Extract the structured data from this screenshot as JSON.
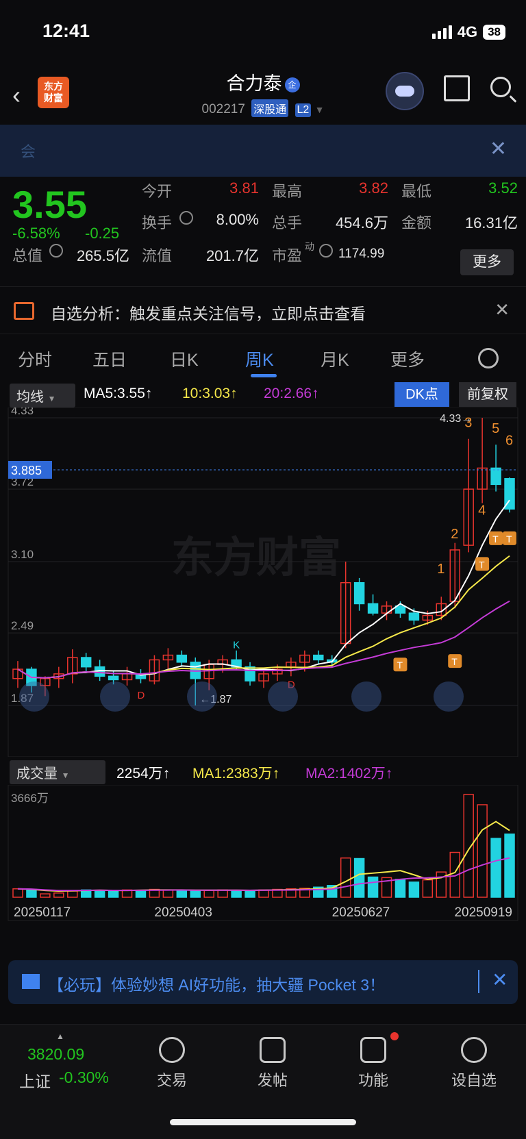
{
  "status": {
    "time": "12:41",
    "network": "4G",
    "battery": "38"
  },
  "header": {
    "title": "合力泰",
    "title_badge": "企",
    "code": "002217",
    "market_tag": "深股通",
    "level_tag": "L2"
  },
  "notice": {
    "text": "会"
  },
  "quote": {
    "price": "3.55",
    "change_pct": "-6.58%",
    "change": "-0.25",
    "open_label": "今开",
    "open": "3.81",
    "high_label": "最高",
    "high": "3.82",
    "low_label": "最低",
    "low": "3.52",
    "turnover_label": "换手",
    "turnover": "8.00%",
    "volume_label": "总手",
    "volume": "454.6万",
    "amount_label": "金额",
    "amount": "16.31亿",
    "mktcap_label": "总值",
    "mktcap": "265.5亿",
    "float_label": "流值",
    "float": "201.7亿",
    "pe_label": "市盈",
    "pe_sup": "动",
    "pe": "1174.99",
    "more_button": "更多"
  },
  "signal_bar": {
    "text": "自选分析：触发重点关注信号，立即点击查看"
  },
  "tabs": [
    "分时",
    "五日",
    "日K",
    "周K",
    "月K",
    "更多"
  ],
  "active_tab": "周K",
  "ma_bar": {
    "selector": "均线",
    "ma5": "MA5:3.55↑",
    "ma10": "10:3.03↑",
    "ma20": "20:2.66↑",
    "dk_button": "DK点",
    "adjust_button": "前复权"
  },
  "volume_bar": {
    "selector": "成交量",
    "vol": "2254万↑",
    "ma1": "MA1:2383万↑",
    "ma2": "MA2:1402万↑"
  },
  "chart_data": [
    {
      "type": "candlestick",
      "title": "周K",
      "y_ticks": [
        "4.33",
        "3.72",
        "3.10",
        "2.49",
        "1.87"
      ],
      "ylim": [
        1.87,
        4.33
      ],
      "crosshair_price": "3.885",
      "max_label": "4.33→",
      "min_label": "←1.87",
      "candles": [
        [
          2.1,
          2.25,
          2.02,
          2.18
        ],
        [
          2.18,
          2.2,
          1.98,
          2.04
        ],
        [
          2.04,
          2.12,
          1.95,
          2.1
        ],
        [
          2.1,
          2.2,
          2.02,
          2.14
        ],
        [
          2.14,
          2.35,
          2.06,
          2.28
        ],
        [
          2.28,
          2.32,
          2.16,
          2.2
        ],
        [
          2.2,
          2.26,
          2.08,
          2.12
        ],
        [
          2.12,
          2.16,
          2.05,
          2.09
        ],
        [
          2.09,
          2.2,
          2.04,
          2.14
        ],
        [
          2.14,
          2.18,
          2.06,
          2.1
        ],
        [
          2.08,
          2.3,
          2.05,
          2.26
        ],
        [
          2.26,
          2.36,
          2.18,
          2.3
        ],
        [
          2.3,
          2.34,
          2.2,
          2.24
        ],
        [
          2.24,
          2.28,
          1.87,
          2.1
        ],
        [
          2.1,
          2.26,
          2.0,
          2.22
        ],
        [
          2.22,
          2.3,
          2.15,
          2.26
        ],
        [
          2.26,
          2.34,
          2.18,
          2.2
        ],
        [
          2.2,
          2.24,
          2.04,
          2.08
        ],
        [
          2.08,
          2.18,
          2.02,
          2.14
        ],
        [
          2.14,
          2.22,
          2.08,
          2.18
        ],
        [
          2.2,
          2.28,
          2.12,
          2.24
        ],
        [
          2.24,
          2.34,
          2.16,
          2.3
        ],
        [
          2.3,
          2.34,
          2.22,
          2.26
        ],
        [
          2.26,
          2.3,
          2.2,
          2.24
        ],
        [
          2.4,
          3.1,
          2.36,
          2.92
        ],
        [
          2.92,
          2.96,
          2.68,
          2.74
        ],
        [
          2.74,
          2.82,
          2.64,
          2.66
        ],
        [
          2.66,
          2.76,
          2.6,
          2.72
        ],
        [
          2.72,
          2.76,
          2.62,
          2.66
        ],
        [
          2.66,
          2.7,
          2.56,
          2.6
        ],
        [
          2.6,
          2.68,
          2.56,
          2.64
        ],
        [
          2.64,
          2.8,
          2.6,
          2.74
        ],
        [
          2.76,
          3.26,
          2.7,
          3.2
        ],
        [
          3.24,
          4.15,
          3.18,
          3.72
        ],
        [
          3.72,
          4.33,
          3.6,
          3.9
        ],
        [
          3.9,
          4.1,
          3.7,
          3.76
        ],
        [
          3.81,
          3.82,
          3.52,
          3.55
        ]
      ]
    },
    {
      "type": "bar",
      "title": "成交量",
      "y_top_label": "3666万",
      "x_labels": [
        "20250117",
        "20250403",
        "20250627",
        "20250919"
      ],
      "values": [
        300,
        280,
        120,
        150,
        220,
        260,
        240,
        230,
        260,
        240,
        280,
        260,
        250,
        230,
        240,
        260,
        250,
        240,
        260,
        280,
        300,
        320,
        360,
        420,
        1400,
        1380,
        720,
        700,
        640,
        540,
        620,
        900,
        1600,
        3666,
        3300,
        2100,
        2254
      ],
      "ma1": [
        300,
        280,
        240,
        220,
        230,
        240,
        250,
        240,
        240,
        250,
        260,
        260,
        260,
        250,
        250,
        250,
        250,
        245,
        250,
        260,
        270,
        280,
        300,
        330,
        560,
        820,
        860,
        900,
        950,
        800,
        640,
        700,
        880,
        1700,
        2400,
        2700,
        2383
      ],
      "ma2": [
        300,
        290,
        260,
        240,
        240,
        245,
        250,
        245,
        245,
        248,
        252,
        255,
        256,
        252,
        250,
        250,
        250,
        248,
        250,
        254,
        258,
        265,
        275,
        290,
        380,
        480,
        530,
        580,
        640,
        680,
        690,
        720,
        760,
        980,
        1150,
        1300,
        1402
      ]
    }
  ],
  "signals": [
    "1",
    "2",
    "3",
    "4",
    "5",
    "6"
  ],
  "chart_markers": {
    "K": "K",
    "D": "D",
    "T": "T"
  },
  "ad_bar": {
    "text": "【必玩】体验妙想 AI好功能，抽大疆 Pocket 3！"
  },
  "bottom_nav": {
    "index_value": "3820.09",
    "index_name": "上证",
    "index_change": "-0.30%",
    "items": [
      "交易",
      "发帖",
      "功能",
      "设自选"
    ]
  },
  "watermark": "东方财富",
  "colors": {
    "up": "#e8342e",
    "down": "#22d3e0",
    "ma5": "#ffffff",
    "ma10": "#f5e84a",
    "ma20": "#c43bd6",
    "accent": "#3f82ef"
  }
}
